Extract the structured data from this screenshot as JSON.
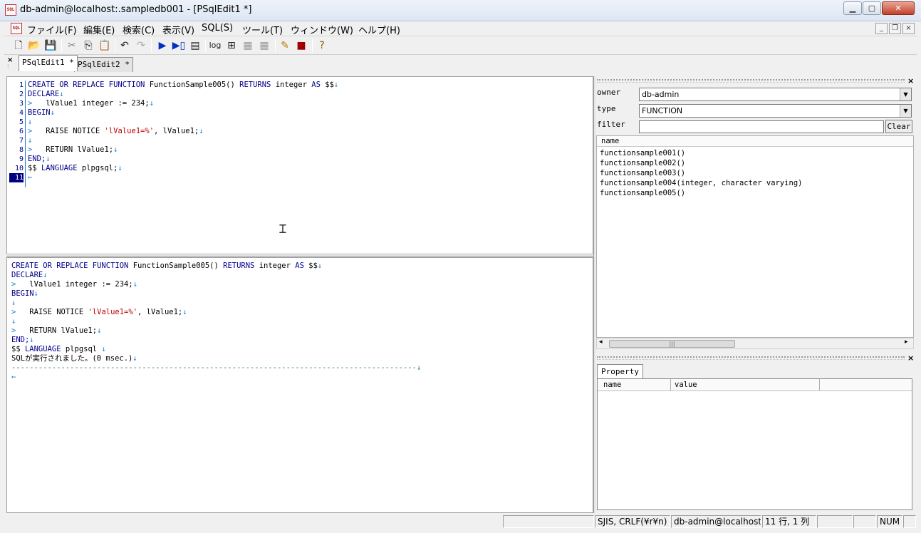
{
  "window": {
    "title": "db-admin@localhost:.sampledb001 - [PSqlEdit1 *]",
    "icon_text": "SQL"
  },
  "menu": [
    "ファイル(F)",
    "編集(E)",
    "検索(C)",
    "表示(V)",
    "SQL(S)",
    "ツール(T)",
    "ウィンドウ(W)",
    "ヘルプ(H)"
  ],
  "toolbar": {
    "log_label": "log"
  },
  "tabs": [
    {
      "label": "PSqlEdit1 *"
    },
    {
      "label": "PSqlEdit2 *"
    }
  ],
  "editor": {
    "line_numbers": [
      "1",
      "2",
      "3",
      "4",
      "5",
      "6",
      "7",
      "8",
      "9",
      "10",
      "11"
    ],
    "lines": [
      [
        {
          "t": "CREATE OR REPLACE FUNCTION ",
          "c": "kw"
        },
        {
          "t": "FunctionSample005() ",
          "c": "n"
        },
        {
          "t": "RETURNS ",
          "c": "kw"
        },
        {
          "t": "integer ",
          "c": "n"
        },
        {
          "t": "AS ",
          "c": "kw"
        },
        {
          "t": "$$",
          "c": "n"
        },
        {
          "t": "↓",
          "c": "mk"
        }
      ],
      [
        {
          "t": "DECLARE",
          "c": "kw"
        },
        {
          "t": "↓",
          "c": "mk"
        }
      ],
      [
        {
          "t": ">   ",
          "c": "mk"
        },
        {
          "t": "lValue1 integer := 234;",
          "c": "n"
        },
        {
          "t": "↓",
          "c": "mk"
        }
      ],
      [
        {
          "t": "BEGIN",
          "c": "kw"
        },
        {
          "t": "↓",
          "c": "mk"
        }
      ],
      [
        {
          "t": "↓",
          "c": "mk"
        }
      ],
      [
        {
          "t": ">   ",
          "c": "mk"
        },
        {
          "t": "RAISE NOTICE ",
          "c": "n"
        },
        {
          "t": "'lValue1=%'",
          "c": "str"
        },
        {
          "t": ", lValue1;",
          "c": "n"
        },
        {
          "t": "↓",
          "c": "mk"
        }
      ],
      [
        {
          "t": "↓",
          "c": "mk"
        }
      ],
      [
        {
          "t": ">   ",
          "c": "mk"
        },
        {
          "t": "RETURN lValue1;",
          "c": "n"
        },
        {
          "t": "↓",
          "c": "mk"
        }
      ],
      [
        {
          "t": "END;",
          "c": "kw"
        },
        {
          "t": "↓",
          "c": "mk"
        }
      ],
      [
        {
          "t": "$$ ",
          "c": "n"
        },
        {
          "t": "LANGUAGE ",
          "c": "kw"
        },
        {
          "t": "plpgsql;",
          "c": "n"
        },
        {
          "t": "↓",
          "c": "mk"
        }
      ],
      [
        {
          "t": "←",
          "c": "mk"
        }
      ]
    ]
  },
  "output": {
    "lines": [
      [
        {
          "t": "CREATE OR REPLACE FUNCTION ",
          "c": "kw"
        },
        {
          "t": "FunctionSample005() ",
          "c": "n"
        },
        {
          "t": "RETURNS ",
          "c": "kw"
        },
        {
          "t": "integer ",
          "c": "n"
        },
        {
          "t": "AS ",
          "c": "kw"
        },
        {
          "t": "$$",
          "c": "n"
        },
        {
          "t": "↓",
          "c": "mk"
        }
      ],
      [
        {
          "t": "DECLARE",
          "c": "kw"
        },
        {
          "t": "↓",
          "c": "mk"
        }
      ],
      [
        {
          "t": ">   ",
          "c": "mk"
        },
        {
          "t": "lValue1 integer := 234;",
          "c": "n"
        },
        {
          "t": "↓",
          "c": "mk"
        }
      ],
      [
        {
          "t": "BEGIN",
          "c": "kw"
        },
        {
          "t": "↓",
          "c": "mk"
        }
      ],
      [
        {
          "t": "↓",
          "c": "mk"
        }
      ],
      [
        {
          "t": ">   ",
          "c": "mk"
        },
        {
          "t": "RAISE NOTICE ",
          "c": "n"
        },
        {
          "t": "'lValue1=%'",
          "c": "str"
        },
        {
          "t": ", lValue1;",
          "c": "n"
        },
        {
          "t": "↓",
          "c": "mk"
        }
      ],
      [
        {
          "t": "↓",
          "c": "mk"
        }
      ],
      [
        {
          "t": ">   ",
          "c": "mk"
        },
        {
          "t": "RETURN lValue1;",
          "c": "n"
        },
        {
          "t": "↓",
          "c": "mk"
        }
      ],
      [
        {
          "t": "END;",
          "c": "kw"
        },
        {
          "t": "↓",
          "c": "mk"
        }
      ],
      [
        {
          "t": "$$ ",
          "c": "n"
        },
        {
          "t": "LANGUAGE ",
          "c": "kw"
        },
        {
          "t": "plpgsql ",
          "c": "n"
        },
        {
          "t": "↓",
          "c": "mk"
        }
      ],
      [
        {
          "t": "SQLが実行されました。(0 msec.)",
          "c": "n"
        },
        {
          "t": "↓",
          "c": "mk"
        }
      ],
      [
        {
          "t": "------------------------------------------------------------------------------------------↓",
          "c": "sep"
        }
      ],
      [
        {
          "t": "←",
          "c": "mk"
        }
      ]
    ]
  },
  "object_panel": {
    "owner_label": "owner",
    "owner_value": "db-admin",
    "type_label": "type",
    "type_value": "FUNCTION",
    "filter_label": "filter",
    "filter_value": "",
    "clear_label": "Clear",
    "list_header": "name",
    "items": [
      "functionsample001()",
      "functionsample002()",
      "functionsample003()",
      "functionsample004(integer, character varying)",
      "functionsample005()"
    ]
  },
  "property_panel": {
    "tab_label": "Property",
    "col_name": "name",
    "col_value": "value"
  },
  "status": {
    "encoding": "SJIS, CRLF(¥r¥n)",
    "connection": "db-admin@localhost:",
    "position": "11 行, 1 列",
    "num": "NUM"
  },
  "colors": {
    "keyword": "#00008b",
    "string": "#c00000",
    "marker": "#1a7fd0",
    "separator": "#2e8b57"
  }
}
